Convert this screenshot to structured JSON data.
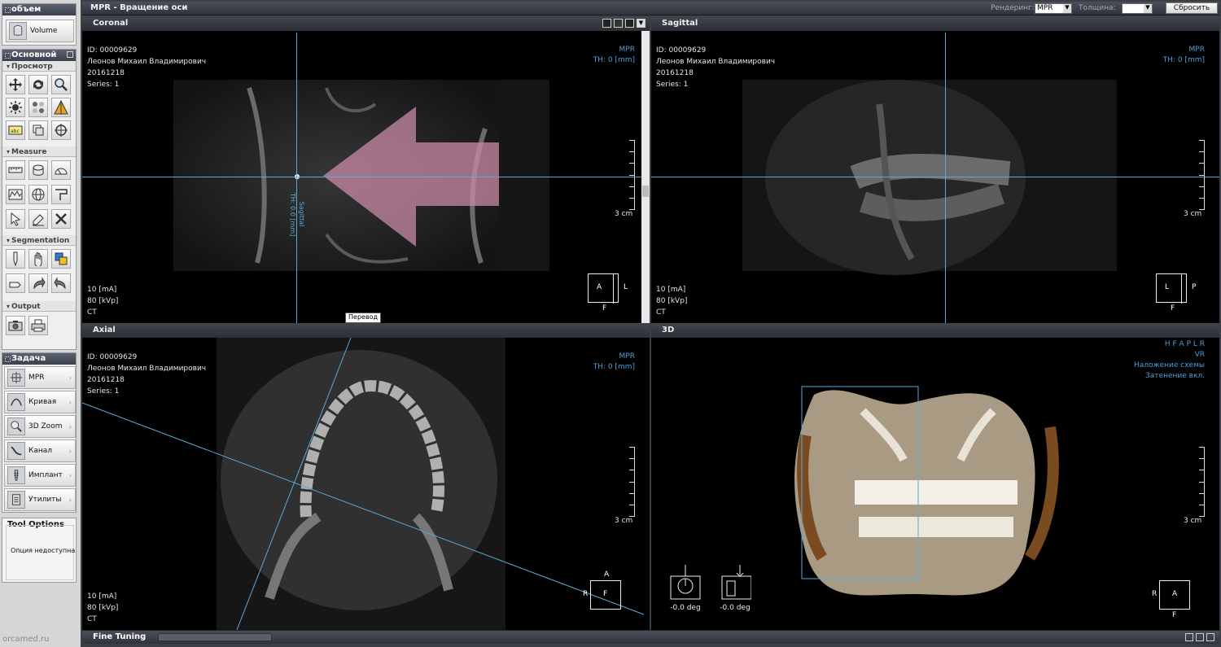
{
  "sidebar": {
    "volume_header": "объем",
    "volume_button": "Volume",
    "main_header": "Основной",
    "sections": {
      "view": "Просмотр",
      "measure": "Measure",
      "segmentation": "Segmentation",
      "output": "Output"
    },
    "task_header": "Задача",
    "tasks": [
      "MPR",
      "Кривая",
      "3D Zoom",
      "Канал",
      "Имплант",
      "Утилиты"
    ],
    "tool_options_header": "Tool Options",
    "tool_options_text": "Опция недоступна"
  },
  "watermark": "orcamed.ru",
  "topbar": {
    "title": "MPR - Вращение оси",
    "rendering_label": "Рендеринг:",
    "rendering_value": "MPR",
    "thickness_label": "Толщина:",
    "reset_label": "Сбросить"
  },
  "viewports": {
    "coronal": {
      "title": "Coronal",
      "info": "ID: 00009629\nЛеонов Михаил Владимирович\n20161218\nSeries: 1",
      "mode": "MPR",
      "th": "TH: 0 [mm]",
      "params": "10 [mA]\n80 [kVp]\nCT",
      "scale": "3 cm",
      "cube": {
        "c": "A",
        "r": "L",
        "b": "F"
      },
      "line_label": "Sagittal\nTH: 0.0 [mm]",
      "tooltip": "Перевод"
    },
    "sagittal": {
      "title": "Sagittal",
      "info": "ID: 00009629\nЛеонов Михаил Владимирович\n20161218\nSeries: 1",
      "mode": "MPR",
      "th": "TH: 0 [mm]",
      "params": "10 [mA]\n80 [kVp]\nCT",
      "scale": "3 cm",
      "cube": {
        "c": "L",
        "r": "P",
        "b": "F"
      }
    },
    "axial": {
      "title": "Axial",
      "info": "ID: 00009629\nЛеонов Михаил Владимирович\n20161218\nSeries: 1",
      "mode": "MPR",
      "th": "TH: 0 [mm]",
      "params": "10 [mA]\n80 [kVp]\nCT",
      "scale": "3 cm",
      "cube": {
        "t": "A",
        "c": "F",
        "l": "R"
      }
    },
    "three_d": {
      "title": "3D",
      "orient": "H F A P L R",
      "mode": "VR",
      "overlay": "Наложение схемы",
      "shading": "Затенение вкл.",
      "scale": "3 cm",
      "cube": {
        "c": "A",
        "l": "R",
        "b": "F"
      },
      "angle1": "-0.0 deg",
      "angle2": "-0.0 deg"
    }
  },
  "fine_tuning": "Fine Tuning",
  "colors": {
    "accent": "#4d9fd6",
    "crosshair": "#5aa9d8",
    "arrow": "#c98aa8"
  }
}
